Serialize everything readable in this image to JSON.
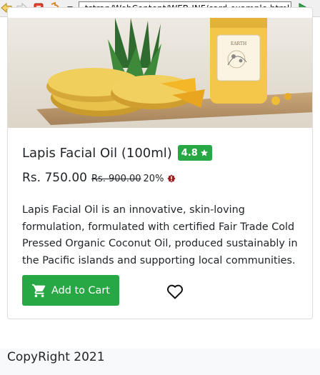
{
  "browser": {
    "url": "›tstrap/WebContent/WEB-INF/card-example.html#",
    "icons": [
      "back-arrow-icon",
      "forward-arrow-icon",
      "stop-icon",
      "refresh-icon",
      "dropdown-arrow-icon",
      "url-dropdown-icon",
      "go-icon"
    ]
  },
  "card": {
    "image": {
      "jar_label": "EARTH",
      "description": "Pineapple slices and a jar of oil on a wooden board"
    },
    "title": "Lapis Facial Oil (100ml)",
    "rating": "4.8",
    "rating_icon": "star-icon",
    "price": "Rs. 750.00",
    "old_price": "Rs. 900.00",
    "discount": "20%",
    "discount_icon": "alert-icon",
    "description": "Lapis Facial Oil is an innovative, skin-loving formulation, formulated with certified Fair Trade Cold Pressed Organic Coconut Oil, produced sustainably in the Pacific islands and supporting local communities.",
    "cart_button": "Add to Cart",
    "cart_icon": "cart-icon",
    "wishlist_icon": "heart-icon"
  },
  "colors": {
    "accent": "#28a745",
    "alert": "#9b1c1c",
    "footer_bg": "#f8f9fa"
  },
  "footer": {
    "text": "CopyRight 2021"
  }
}
